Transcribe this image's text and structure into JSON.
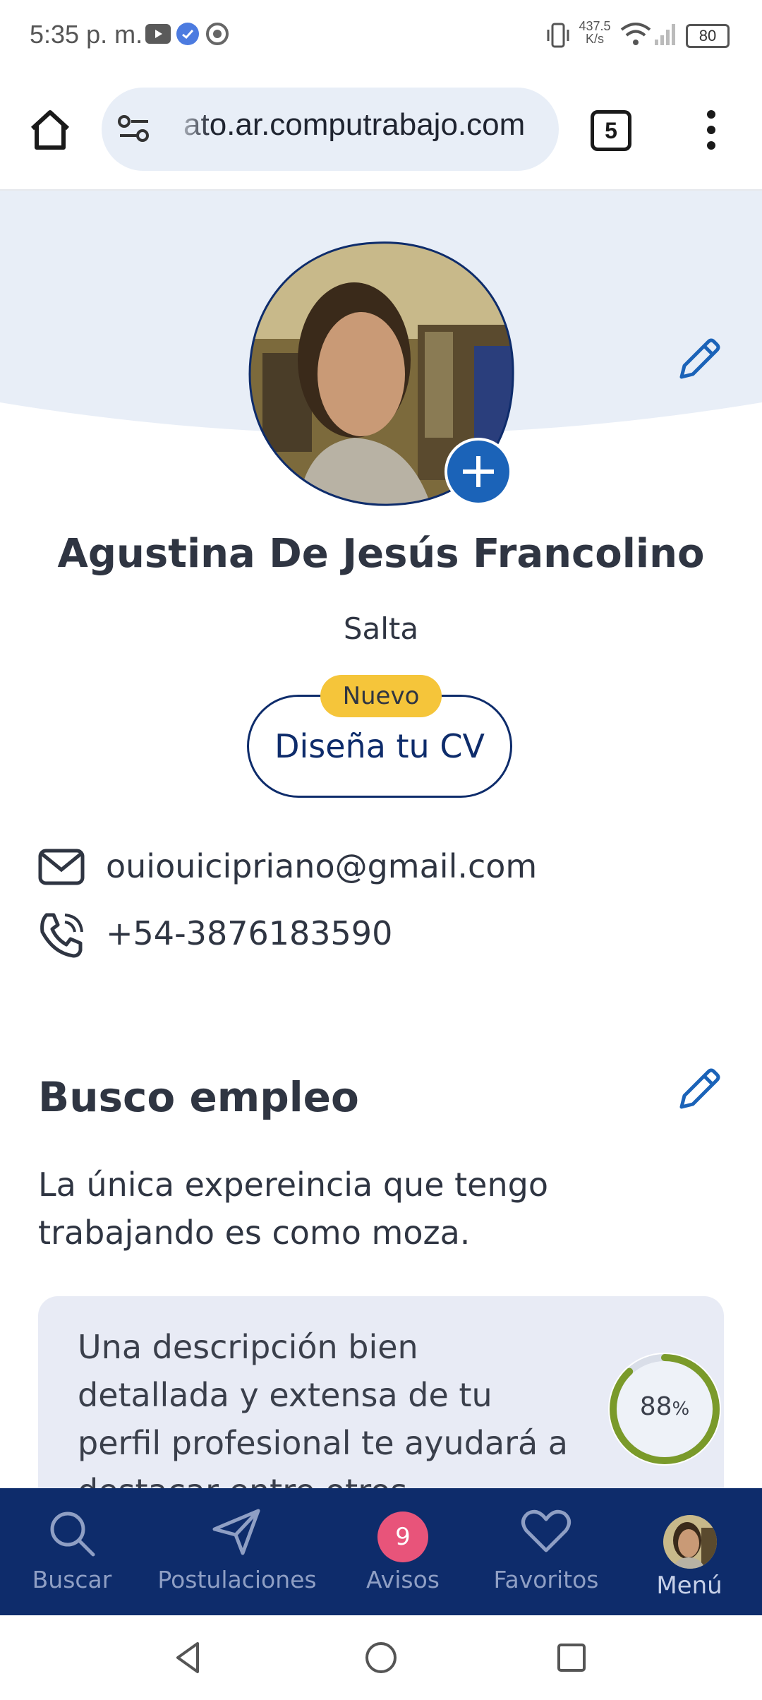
{
  "status_bar": {
    "time": "5:35 p. m.",
    "net_speed": "437.5",
    "net_unit": "K/s",
    "battery": "80"
  },
  "browser": {
    "url": "ato.ar.computrabajo.com",
    "tab_count": "5"
  },
  "profile": {
    "name": "Agustina De Jesús Francolino",
    "city": "Salta",
    "cv_badge": "Nuevo",
    "cv_button": "Diseña tu CV",
    "email": "ouiouicipriano@gmail.com",
    "phone": "+54-3876183590"
  },
  "section": {
    "title": "Busco empleo",
    "body": "La única expereincia que tengo trabajando es como moza."
  },
  "tip": {
    "text": "Una descripción bien detallada y extensa de tu perfil profesional te ayudará a destacar entre otros",
    "progress_value": "88",
    "progress_unit": "%"
  },
  "bottom_nav": {
    "items": [
      {
        "label": "Buscar"
      },
      {
        "label": "Postulaciones"
      },
      {
        "label": "Avisos",
        "badge": "9"
      },
      {
        "label": "Favoritos"
      },
      {
        "label": "Menú"
      }
    ]
  },
  "colors": {
    "brand_navy": "#0e2c6b",
    "accent_blue": "#1b63b8",
    "badge_yellow": "#f5c53a",
    "notification_pink": "#e8547a",
    "progress_green": "#7a9a2a"
  }
}
